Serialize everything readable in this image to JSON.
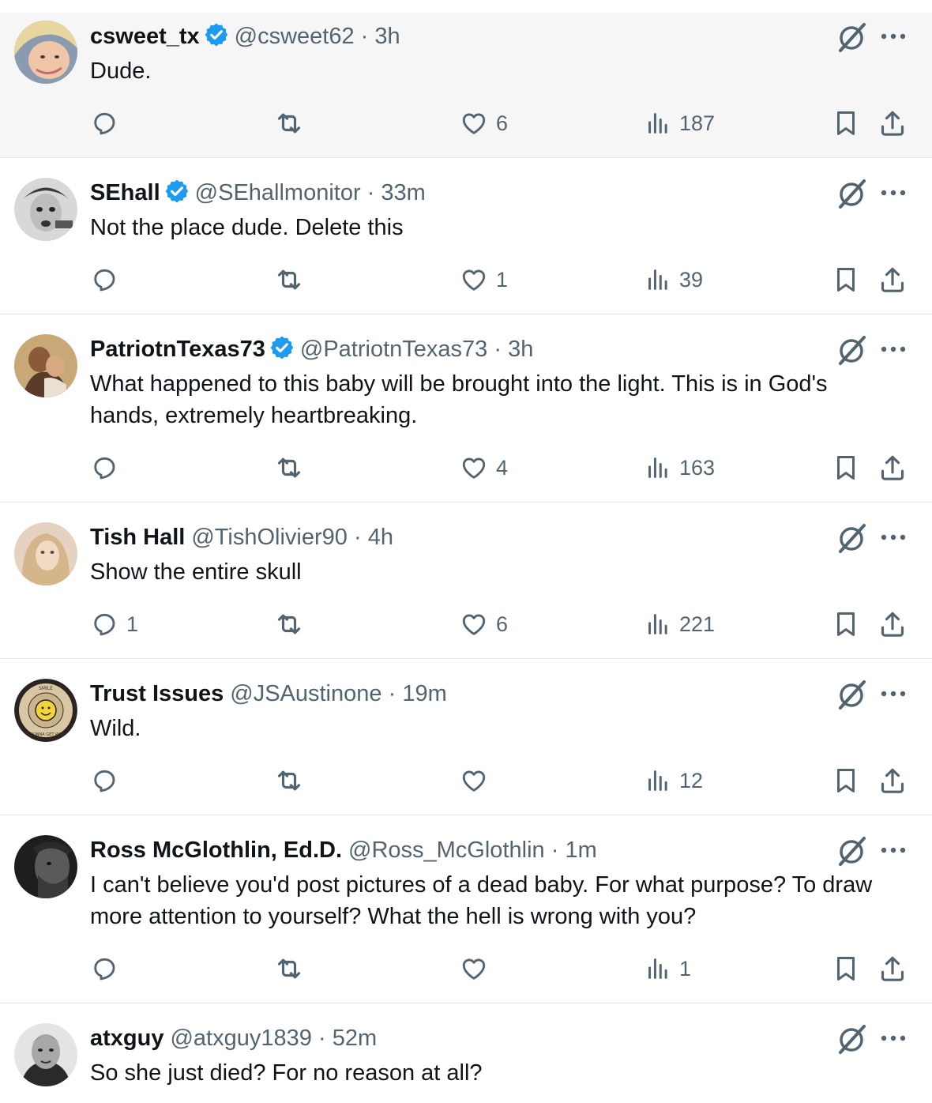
{
  "colors": {
    "verified": "#1d9bf0",
    "icon": "#536471",
    "text": "#0f1419",
    "secondary": "#536471",
    "highlight_bg": "#f6f6f6",
    "divider": "#e3e6e8"
  },
  "icons": {
    "verified": "verified-badge-icon",
    "grok": "grok-icon",
    "more": "more-icon",
    "reply": "reply-icon",
    "retweet": "retweet-icon",
    "like": "like-icon",
    "views": "views-icon",
    "bookmark": "bookmark-icon",
    "share": "share-icon"
  },
  "tweets": [
    {
      "name": "csweet_tx",
      "verified": true,
      "handle": "@csweet62",
      "sep": "·",
      "time": "3h",
      "text": "Dude.",
      "replies": "",
      "likes": "6",
      "views": "187"
    },
    {
      "name": "SEhall",
      "verified": true,
      "handle": "@SEhallmonitor",
      "sep": "·",
      "time": "33m",
      "text": "Not the place dude. Delete this",
      "replies": "",
      "likes": "1",
      "views": "39"
    },
    {
      "name": "PatriotnTexas73",
      "verified": true,
      "handle": "@PatriotnTexas73",
      "sep": "·",
      "time": "3h",
      "text": "What happened to this baby will be brought into the light. This is in God's hands, extremely heartbreaking.",
      "replies": "",
      "likes": "4",
      "views": "163"
    },
    {
      "name": "Tish Hall",
      "verified": false,
      "handle": "@TishOlivier90",
      "sep": "·",
      "time": "4h",
      "text": "Show the entire skull",
      "replies": "1",
      "likes": "6",
      "views": "221"
    },
    {
      "name": "Trust Issues",
      "verified": false,
      "handle": "@JSAustinone",
      "sep": "·",
      "time": "19m",
      "text": "Wild.",
      "replies": "",
      "likes": "",
      "views": "12",
      "avatar_text": [
        "SMILE",
        "IT'S GONNA GET WORSE"
      ]
    },
    {
      "name": "Ross McGlothlin, Ed.D.",
      "verified": false,
      "handle": "@Ross_McGlothlin",
      "sep": "·",
      "time": "1m",
      "text": "I can't believe you'd post pictures of a dead baby. For what purpose? To draw more attention to yourself? What the hell is wrong with you?",
      "replies": "",
      "likes": "",
      "views": "1"
    },
    {
      "name": "atxguy",
      "verified": false,
      "handle": "@atxguy1839",
      "sep": "·",
      "time": "52m",
      "text": "So she just died? For no reason at all?"
    }
  ]
}
